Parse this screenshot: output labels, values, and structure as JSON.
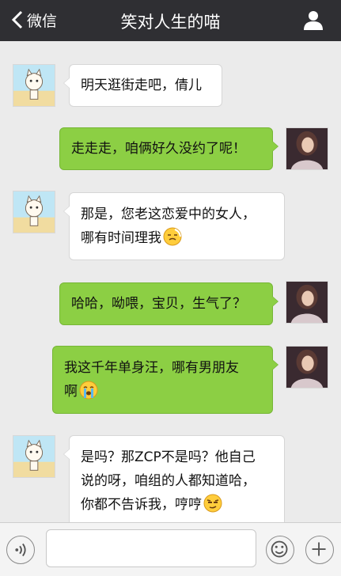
{
  "header": {
    "back_label": "微信",
    "title": "笑对人生的喵",
    "back_icon": "chevron-left-icon",
    "contact_icon": "person-icon"
  },
  "messages": [
    {
      "side": "left",
      "lines": [
        "明天逛街走吧，倩儿"
      ]
    },
    {
      "side": "right",
      "lines": [
        "走走走，咱俩好久没约了呢！"
      ]
    },
    {
      "side": "left",
      "lines": [
        "那是，您老这恋爱中的女人，",
        "哪有时间理我"
      ],
      "emoji": "embarrassed-emoji-icon"
    },
    {
      "side": "right",
      "lines": [
        "哈哈，呦喂，宝贝，生气了？"
      ]
    },
    {
      "side": "right",
      "lines": [
        "我这千年单身汪，哪有男朋友",
        "啊"
      ],
      "emoji": "crying-emoji-icon"
    },
    {
      "side": "left",
      "lines": [
        "是吗？那ZCP不是吗？他自己",
        "说的呀，咱组的人都知道哈，",
        "你都不告诉我，哼哼"
      ],
      "emoji": "smug-emoji-icon"
    }
  ],
  "input": {
    "value": "",
    "placeholder": ""
  },
  "colors": {
    "topbar": "#2f2f33",
    "background": "#ebebeb",
    "sent_bubble": "#8ccf44",
    "received_bubble": "#ffffff"
  }
}
